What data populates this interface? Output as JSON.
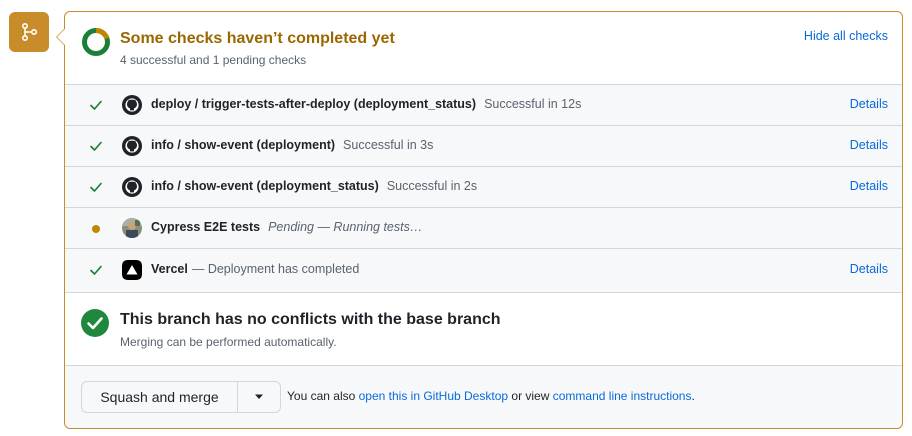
{
  "header": {
    "title": "Some checks haven’t completed yet",
    "subtitle": "4 successful and 1 pending checks",
    "hide_link": "Hide all checks",
    "progress": {
      "successful": 4,
      "pending": 1
    }
  },
  "checks": [
    {
      "status": "success",
      "avatar": "github-logo",
      "name": "deploy / trigger-tests-after-deploy (deployment_status)",
      "description": "Successful in 12s",
      "details": "Details"
    },
    {
      "status": "success",
      "avatar": "github-logo",
      "name": "info / show-event (deployment)",
      "description": "Successful in 3s",
      "details": "Details"
    },
    {
      "status": "success",
      "avatar": "github-logo",
      "name": "info / show-event (deployment_status)",
      "description": "Successful in 2s",
      "details": "Details"
    },
    {
      "status": "pending",
      "avatar": "cypress-avatar",
      "name": "Cypress E2E tests",
      "description": "Pending — Running tests…",
      "details": ""
    },
    {
      "status": "success",
      "avatar": "vercel-logo",
      "name": "Vercel",
      "description": "— Deployment has completed",
      "details": "Details"
    }
  ],
  "merge_status": {
    "title": "This branch has no conflicts with the base branch",
    "subtitle": "Merging can be performed automatically."
  },
  "footer": {
    "merge_button": "Squash and merge",
    "text_prefix": "You can also",
    "desktop_link": "open this in GitHub Desktop",
    "text_middle": "or view",
    "cli_link": "command line instructions",
    "text_suffix": "."
  },
  "colors": {
    "accent_attention": "#c98c2a",
    "title_attention": "#9a6700",
    "success": "#1a7f37",
    "link": "#0969da"
  }
}
